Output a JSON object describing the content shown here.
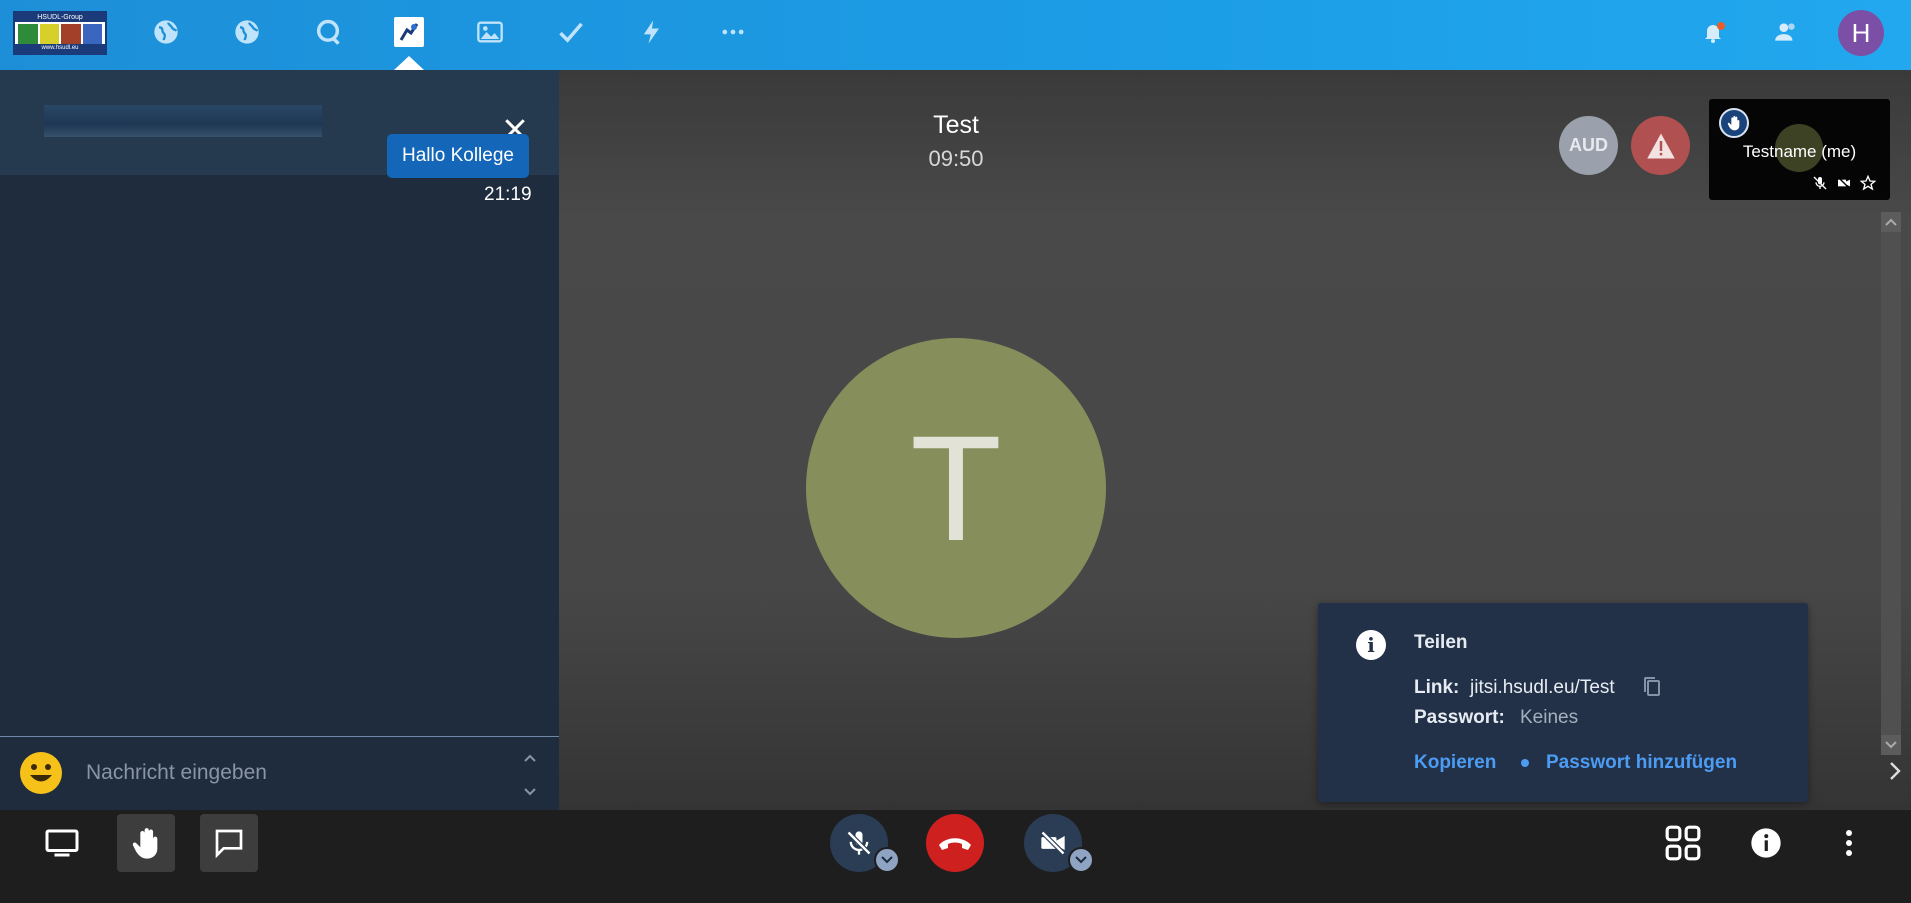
{
  "topbar": {
    "logo_text_top": "HSUDL-Group",
    "logo_text_bottom": "www.hsudl.eu",
    "nav_icons": [
      "globe-icon",
      "globe-icon",
      "chat-search-icon",
      "jitsi-app-icon",
      "image-icon",
      "check-icon",
      "bolt-icon",
      "more-icon"
    ],
    "right_icons": [
      "bell-icon",
      "contacts-icon"
    ],
    "avatar_letter": "H",
    "avatar_color": "#7b4fa6",
    "accent": "#1c9de6"
  },
  "chat": {
    "messages": [
      {
        "text": "Hallo Kollege",
        "time": "21:19"
      }
    ],
    "input_placeholder": "Nachricht eingeben",
    "bubble_color": "#1466b8"
  },
  "conference": {
    "title": "Test",
    "elapsed": "09:50",
    "participant_letter": "T",
    "avatar_color": "#868f5b",
    "aud_badge": "AUD",
    "thumbnail_name": "Testname (me)",
    "thumbnail_letter": "T"
  },
  "info_popup": {
    "title": "Teilen",
    "link_label": "Link:",
    "link_value": "jitsi.hsudl.eu/Test",
    "password_label": "Passwort:",
    "password_value": "Keines",
    "copy_action": "Kopieren",
    "add_password_action": "Passwort hinzufügen",
    "link_color": "#4c9cf4"
  },
  "toolbar": {
    "left": [
      "screen-share-icon",
      "raise-hand-icon",
      "chat-icon"
    ],
    "center": [
      "mic-muted-icon",
      "hangup-icon",
      "camera-off-icon"
    ],
    "right": [
      "tile-view-icon",
      "info-icon",
      "more-vertical-icon"
    ],
    "hangup_color": "#cf2020"
  }
}
